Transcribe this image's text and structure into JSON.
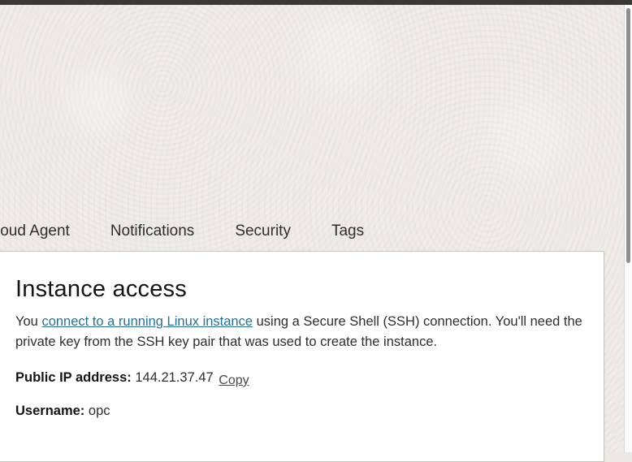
{
  "tabs": [
    {
      "label": "loud Agent"
    },
    {
      "label": "Notifications"
    },
    {
      "label": "Security"
    },
    {
      "label": "Tags"
    }
  ],
  "instance_access": {
    "title": "Instance access",
    "desc_before": "You ",
    "desc_link": "connect to a running Linux instance",
    "desc_after": " using a Secure Shell (SSH) connection. You'll need the private key from the SSH key pair that was used to create the instance.",
    "public_ip_label": "Public IP address:",
    "public_ip_value": "144.21.37.47",
    "copy_label": "Copy",
    "username_label": "Username:",
    "username_value": "opc"
  }
}
